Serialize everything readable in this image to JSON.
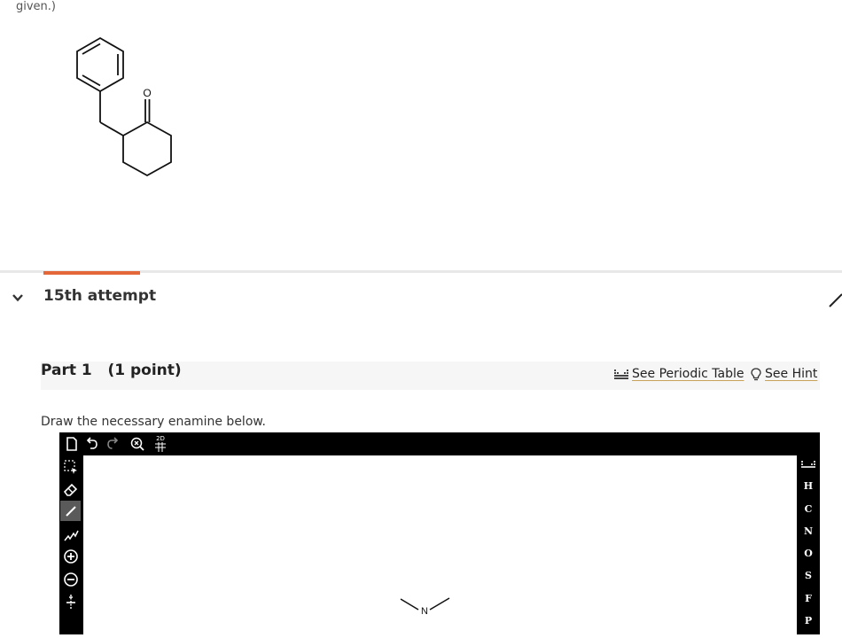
{
  "question": {
    "top_text": "given.)"
  },
  "molecule": {
    "atom_label": "O"
  },
  "attempt": {
    "title": "15th attempt"
  },
  "part": {
    "title": "Part 1   (1 point)",
    "periodic_link": "See Periodic Table",
    "hint_link": "See Hint"
  },
  "instruction": "Draw the necessary enamine below.",
  "editor": {
    "top_tools": [
      "new-document-icon",
      "undo-icon",
      "redo-icon",
      "zoom-reset-icon",
      "2d-clean-icon"
    ],
    "top_tool_label_2d": "2D",
    "left_tools": [
      "selection-icon",
      "eraser-icon",
      "single-bond-icon",
      "chain-icon",
      "charge-plus-icon",
      "charge-minus-icon",
      "charge-toggle-icon"
    ],
    "elements": [
      "H",
      "C",
      "N",
      "O",
      "S",
      "F",
      "P"
    ],
    "canvas_atom_label": "N"
  },
  "colors": {
    "accent": "#e4673a",
    "editor_frame": "#000000",
    "link_underline": "#c9a25a"
  }
}
